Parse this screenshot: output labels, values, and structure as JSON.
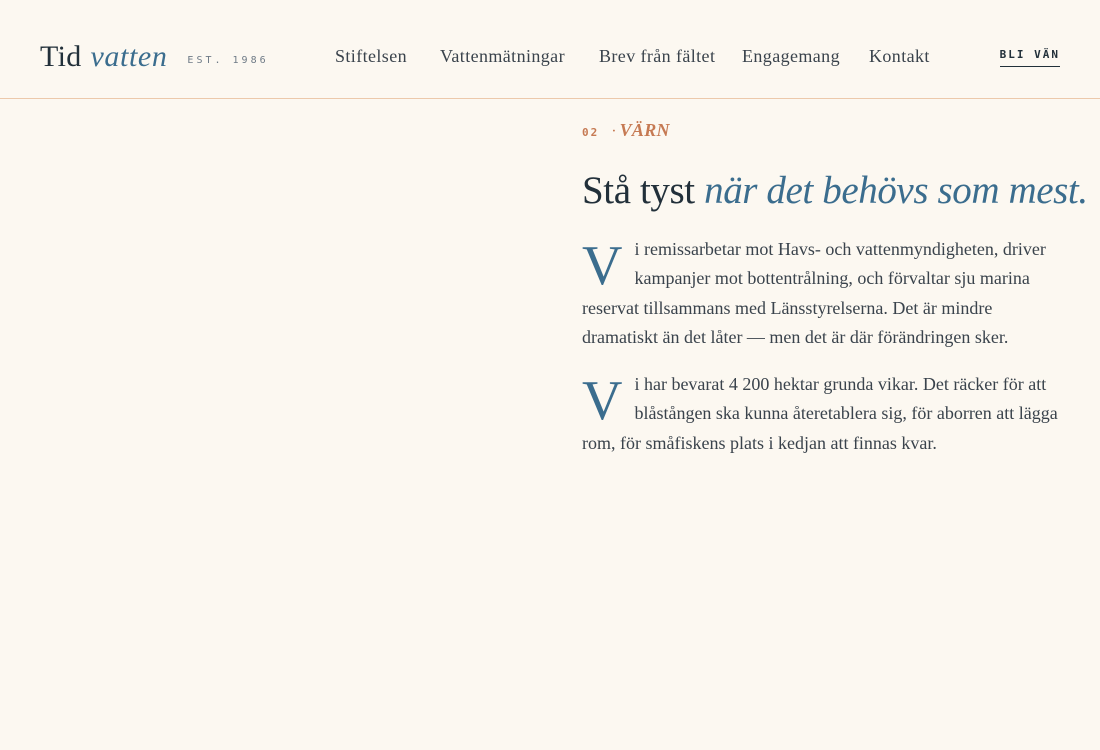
{
  "brand": {
    "main": "Tid",
    "italic": "vatten",
    "est": "EST. 1986"
  },
  "nav": {
    "items": [
      {
        "label": "Stiftelsen"
      },
      {
        "label": "Vattenmätningar"
      },
      {
        "label": "Brev från fältet"
      },
      {
        "label": "Engagemang"
      },
      {
        "label": "Kontakt"
      }
    ],
    "cta": "BLI VÄN"
  },
  "section": {
    "number": "02",
    "dot": "·",
    "label": "VÄRN",
    "headline_plain": "Stå tyst",
    "headline_accent": "när det behövs som mest.",
    "paragraphs": [
      {
        "drop_cap": "V",
        "text": "i remissarbetar mot Havs- och vattenmyndigheten, driver kampanjer mot bottentrålning, och förvaltar sju marina reservat tillsammans med Länsstyrelserna. Det är mindre dramatiskt än det låter — men det är där förändringen sker."
      },
      {
        "drop_cap": "V",
        "text": "i har bevarat 4 200 hektar grunda vikar. Det räcker för att blåstången ska kunna återetablera sig, för aborren att lägga rom, för småfiskens plats i kedjan att finnas kvar."
      }
    ]
  },
  "colors": {
    "background": "#fcf8f1",
    "ink": "#22303a",
    "accent_blue": "#3b6d8e",
    "accent_terracotta": "#c67a53",
    "rule": "#ecc9ab"
  }
}
